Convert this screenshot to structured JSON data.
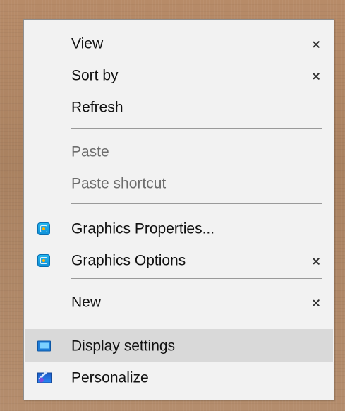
{
  "menu": {
    "items": [
      {
        "label": "View",
        "disabled": false,
        "submenu": true,
        "icon": "",
        "active": false
      },
      {
        "label": "Sort by",
        "disabled": false,
        "submenu": true,
        "icon": "",
        "active": false
      },
      {
        "label": "Refresh",
        "disabled": false,
        "submenu": false,
        "icon": "",
        "active": false
      },
      {
        "label": "Paste",
        "disabled": true,
        "submenu": false,
        "icon": "",
        "active": false
      },
      {
        "label": "Paste shortcut",
        "disabled": true,
        "submenu": false,
        "icon": "",
        "active": false
      },
      {
        "label": "Graphics Properties...",
        "disabled": false,
        "submenu": false,
        "icon": "graphics-icon",
        "active": false
      },
      {
        "label": "Graphics Options",
        "disabled": false,
        "submenu": true,
        "icon": "graphics-icon",
        "active": false
      },
      {
        "label": "New",
        "disabled": false,
        "submenu": true,
        "icon": "",
        "active": false
      },
      {
        "label": "Display settings",
        "disabled": false,
        "submenu": false,
        "icon": "display-settings-icon",
        "active": true
      },
      {
        "label": "Personalize",
        "disabled": false,
        "submenu": false,
        "icon": "personalize-icon",
        "active": false
      }
    ]
  },
  "colors": {
    "menu_background": "#f2f2f2",
    "hover_background": "#d9d9d9",
    "disabled_text": "#6d6d6d",
    "separator": "#9a9a9a"
  }
}
